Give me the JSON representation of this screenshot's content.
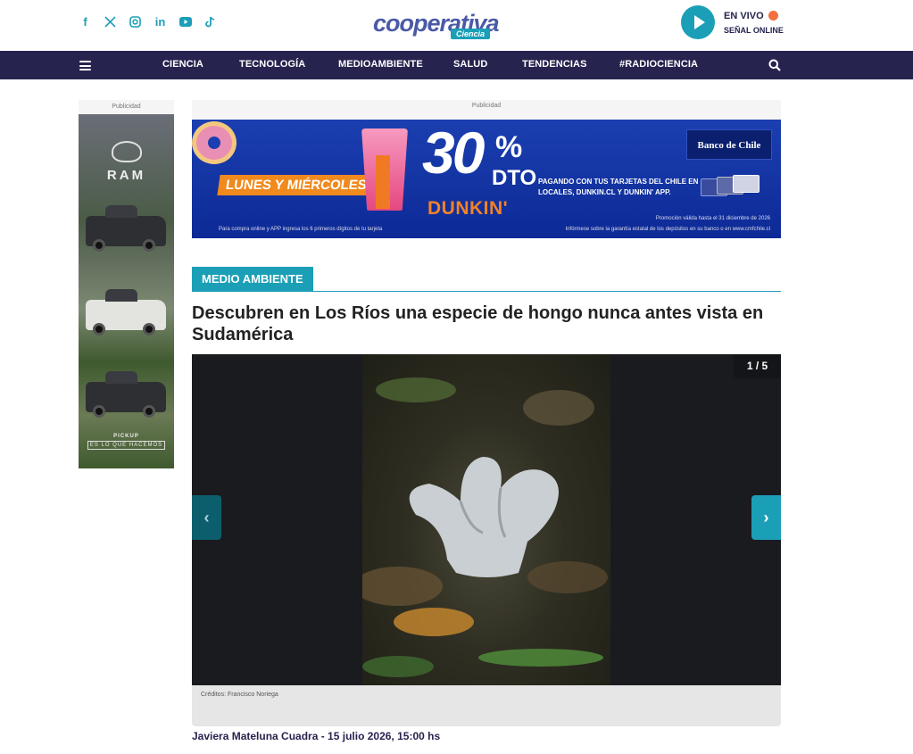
{
  "header": {
    "social_icons": [
      "facebook-icon",
      "x-icon",
      "instagram-icon",
      "linkedin-icon",
      "youtube-icon",
      "tiktok-icon"
    ],
    "logo_text": "cooperativa",
    "logo_tag": "Ciencia",
    "live": {
      "label": "EN VIVO",
      "sublabel": "SEÑAL ONLINE"
    }
  },
  "nav": {
    "items": [
      "CIENCIA",
      "TECNOLOGÍA",
      "MEDIOAMBIENTE",
      "SALUD",
      "TENDENCIAS",
      "#RADIOCIENCIA"
    ]
  },
  "ads": {
    "side_label": "Publicidad",
    "side_brand": "RAM",
    "side_slogan1": "PICKUP",
    "side_slogan2": "ES LO QUE HACEMOS",
    "top_label": "Publicidad",
    "top": {
      "days": "LUNES Y MIÉRCOLES",
      "discount": "30",
      "percent": "%",
      "dto": "DTO",
      "brand": "DUNKIN'",
      "bank": "Banco de Chile",
      "pay_text": "PAGANDO CON TUS TARJETAS DEL CHILE EN LOCALES, DUNKIN.CL Y DUNKIN' APP.",
      "promo": "Promoción válida hasta el 31 diciembre de 2026",
      "online": "Para compra online y APP ingresa los 6 primeros dígitos de tu tarjeta",
      "info": "Infórmese sobre la garantía estatal de los depósitos en su banco o en www.cmfchile.cl"
    }
  },
  "article": {
    "section": "MEDIO AMBIENTE",
    "title": "Descubren en Los Ríos una especie de hongo nunca antes vista en Sudamérica",
    "gallery": {
      "counter": "1 / 5",
      "prev": "‹",
      "next": "›",
      "credits": "Créditos: Francisco Noriega"
    },
    "byline": "Javiera Mateluna Cuadra  - 15 julio 2026, 15:00 hs"
  },
  "colors": {
    "accent": "#1a9fb7",
    "nav_bg": "#27234f",
    "live_dot": "#f2703f"
  }
}
